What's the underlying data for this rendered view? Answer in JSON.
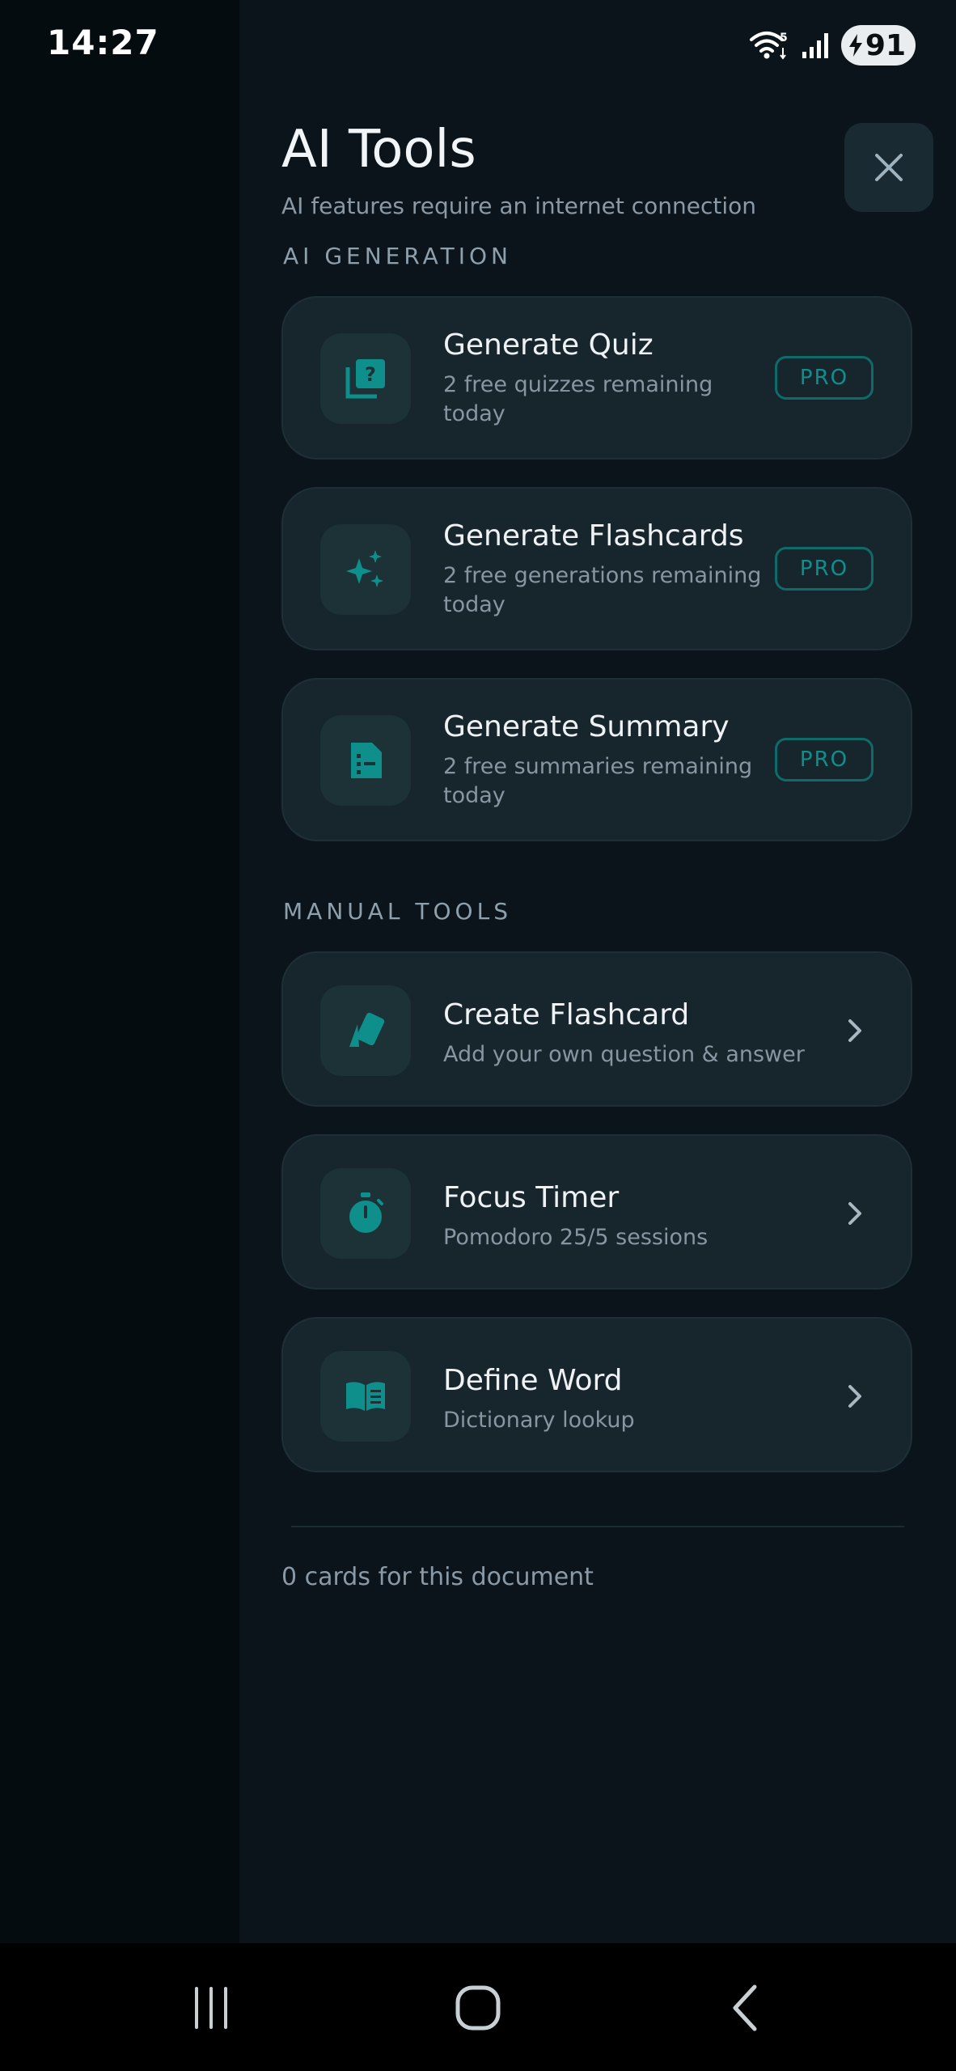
{
  "status_bar": {
    "time": "14:27",
    "wifi_badge": "5",
    "battery_level": "91",
    "icons": [
      "wifi-icon",
      "signal-icon",
      "battery-charging-icon"
    ]
  },
  "header": {
    "title": "AI Tools",
    "subtitle": "AI features require an internet connection",
    "close_icon": "close-icon"
  },
  "sections": {
    "ai_generation": {
      "label": "AI GENERATION",
      "items": [
        {
          "title": "Generate Quiz",
          "subtitle": "2 free quizzes remaining today",
          "badge": "PRO",
          "icon": "quiz-icon"
        },
        {
          "title": "Generate Flashcards",
          "subtitle": "2 free generations remaining today",
          "badge": "PRO",
          "icon": "sparkle-icon"
        },
        {
          "title": "Generate Summary",
          "subtitle": "2 free summaries remaining today",
          "badge": "PRO",
          "icon": "document-icon"
        }
      ]
    },
    "manual_tools": {
      "label": "MANUAL TOOLS",
      "items": [
        {
          "title": "Create Flashcard",
          "subtitle": "Add your own question & answer",
          "icon": "cards-icon"
        },
        {
          "title": "Focus Timer",
          "subtitle": "Pomodoro 25/5 sessions",
          "icon": "stopwatch-icon"
        },
        {
          "title": "Define Word",
          "subtitle": "Dictionary lookup",
          "icon": "book-icon"
        }
      ]
    }
  },
  "footer": {
    "card_count_text": "0 cards for this document"
  },
  "nav_bar": {
    "icons": [
      "recent-apps-icon",
      "home-icon",
      "back-icon"
    ]
  },
  "colors": {
    "accent": "#0f8f8c",
    "panel_bg": "#0b141b",
    "card_bg": "#17252d",
    "text_primary": "#eef2f4",
    "text_secondary": "#8796a2"
  }
}
